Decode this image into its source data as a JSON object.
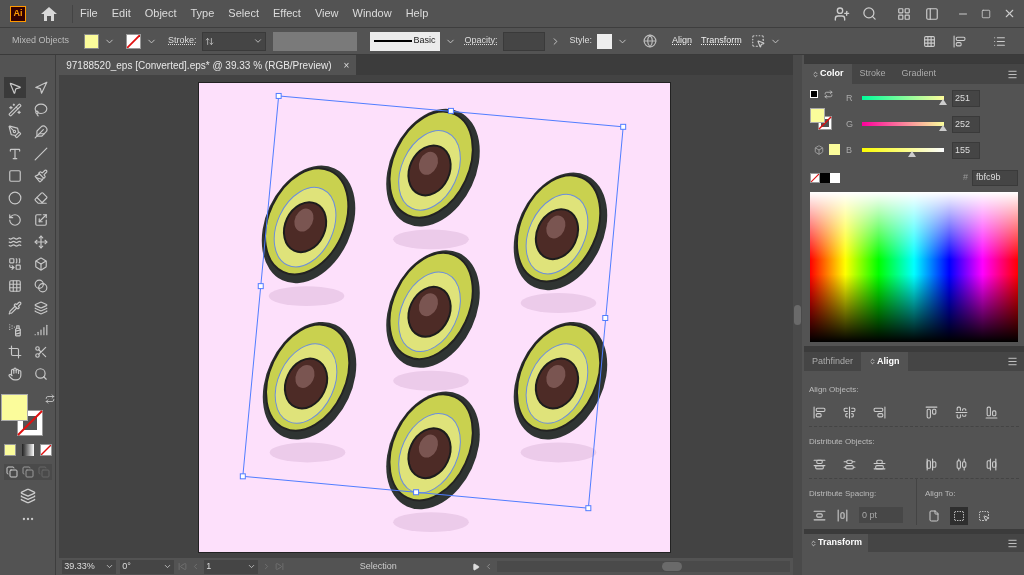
{
  "app_logo": "Ai",
  "menu": [
    "File",
    "Edit",
    "Object",
    "Type",
    "Select",
    "Effect",
    "View",
    "Window",
    "Help"
  ],
  "control_bar": {
    "selection_label": "Mixed Objects",
    "stroke_label": "Stroke:",
    "brush": "Basic",
    "opacity_label": "Opacity:",
    "style_label": "Style:",
    "align_link": "Align",
    "transform_link": "Transform"
  },
  "document_tab": {
    "title": "97188520_eps [Converted].eps* @ 39.33 % (RGB/Preview)",
    "close": "×"
  },
  "color_panel": {
    "tabs": [
      {
        "label": "Color",
        "selected": true
      },
      {
        "label": "Stroke",
        "selected": false
      },
      {
        "label": "Gradient",
        "selected": false
      }
    ],
    "channels": [
      {
        "label": "R",
        "value": "251",
        "level": 0.984
      },
      {
        "label": "G",
        "value": "252",
        "level": 0.988
      },
      {
        "label": "B",
        "value": "155",
        "level": 0.608
      }
    ],
    "hex_prefix": "#",
    "hex": "fbfc9b"
  },
  "align_panel": {
    "tabs": [
      {
        "label": "Pathfinder",
        "selected": false
      },
      {
        "label": "Align",
        "selected": true
      }
    ],
    "align_objects": "Align Objects:",
    "distribute_objects": "Distribute Objects:",
    "distribute_spacing": "Distribute Spacing:",
    "spacing_placeholder": "0 pt",
    "align_to": "Align To:",
    "align_to_options": [
      {
        "selected": false
      },
      {
        "selected": true
      },
      {
        "selected": false
      }
    ]
  },
  "transform_panel": {
    "title": "Transform"
  },
  "status_bar": {
    "zoom": "39.33%",
    "rotation": "0°",
    "artboard": "1",
    "tool": "Selection"
  }
}
